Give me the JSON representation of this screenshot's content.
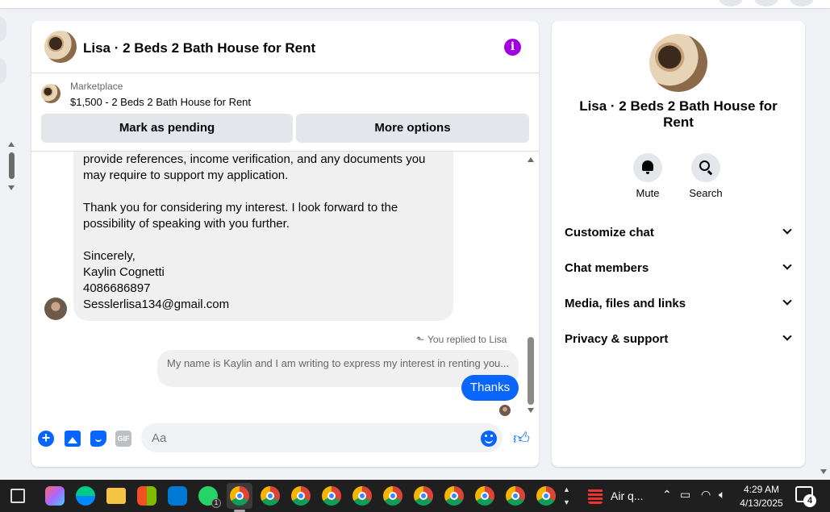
{
  "header": {
    "title": "Lisa · 2 Beds 2 Bath House for Rent",
    "info_icon": "info-icon"
  },
  "marketplace": {
    "label": "Marketplace",
    "listing": "$1,500 - 2 Beds 2 Bath House for Rent",
    "mark_pending": "Mark as pending",
    "more_options": "More options"
  },
  "messages": {
    "incoming": {
      "p1": "provide references, income verification, and any documents you may require to support my application.",
      "p2": "Thank you for considering my interest. I look forward to the possibility of speaking with you further.",
      "signoff": "Sincerely,",
      "name": "Kaylin Cognetti",
      "phone": "4086686897",
      "email": "Sesslerlisa134@gmail.com"
    },
    "replied_label": "You replied to Lisa",
    "quoted": "My name is Kaylin and I am writing to express my interest in renting you...",
    "outgoing": "Thanks"
  },
  "composer": {
    "placeholder": "Aa",
    "gif_label": "GIF"
  },
  "panel": {
    "title": "Lisa · 2 Beds 2 Bath House for Rent",
    "mute": "Mute",
    "search": "Search",
    "sections": [
      "Customize chat",
      "Chat members",
      "Media, files and links",
      "Privacy & support"
    ]
  },
  "taskbar": {
    "whatsapp_badge": "1",
    "weather": "Air q...",
    "time": "4:29 AM",
    "date": "4/13/2025",
    "notifications": "4"
  },
  "colors": {
    "accent": "#0866ff",
    "info": "#a100e0",
    "bubble_in": "#f0f0f0",
    "button_bg": "#e4e6eb"
  }
}
